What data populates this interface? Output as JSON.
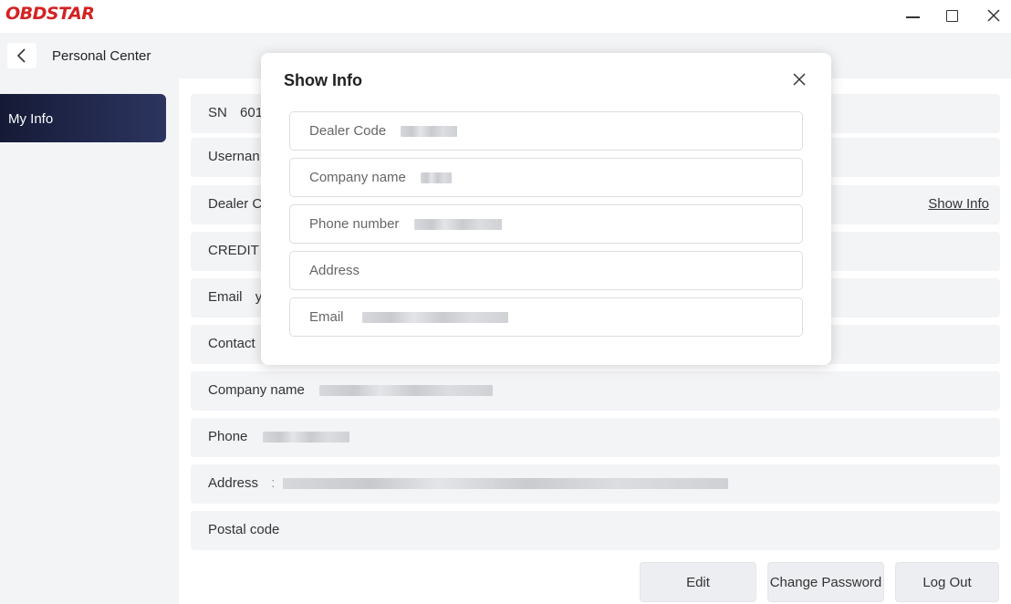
{
  "app": {
    "logo_text": "OBDSTAR",
    "brand_color": "#d42222"
  },
  "window_controls": {
    "minimize_icon": "minimize-icon",
    "maximize_icon": "maximize-icon",
    "close_icon": "close-icon"
  },
  "header": {
    "back_icon": "chevron-left-icon",
    "title": "Personal Center"
  },
  "sidebar": {
    "items": [
      {
        "label": "My Info",
        "active": true
      }
    ],
    "active_color": "#1c2344"
  },
  "info_rows": [
    {
      "label": "SN",
      "value": "601"
    },
    {
      "label": "Usernan",
      "value": ""
    },
    {
      "label": "Dealer C",
      "value": "",
      "action": "Show Info"
    },
    {
      "label": "CREDIT I",
      "value": ""
    },
    {
      "label": "Email",
      "value": "y"
    },
    {
      "label": "Contact",
      "value": ""
    },
    {
      "label": "Company name",
      "value": ""
    },
    {
      "label": "Phone",
      "value": ""
    },
    {
      "label": "Address",
      "value": ":"
    },
    {
      "label": "Postal code",
      "value": ""
    }
  ],
  "buttons": {
    "edit": "Edit",
    "change_password": "Change Password",
    "log_out": "Log Out"
  },
  "modal": {
    "title": "Show Info",
    "close_icon": "close-icon",
    "fields": [
      {
        "label": "Dealer Code"
      },
      {
        "label": "Company name"
      },
      {
        "label": "Phone number"
      },
      {
        "label": "Address"
      },
      {
        "label": "Email"
      }
    ]
  }
}
